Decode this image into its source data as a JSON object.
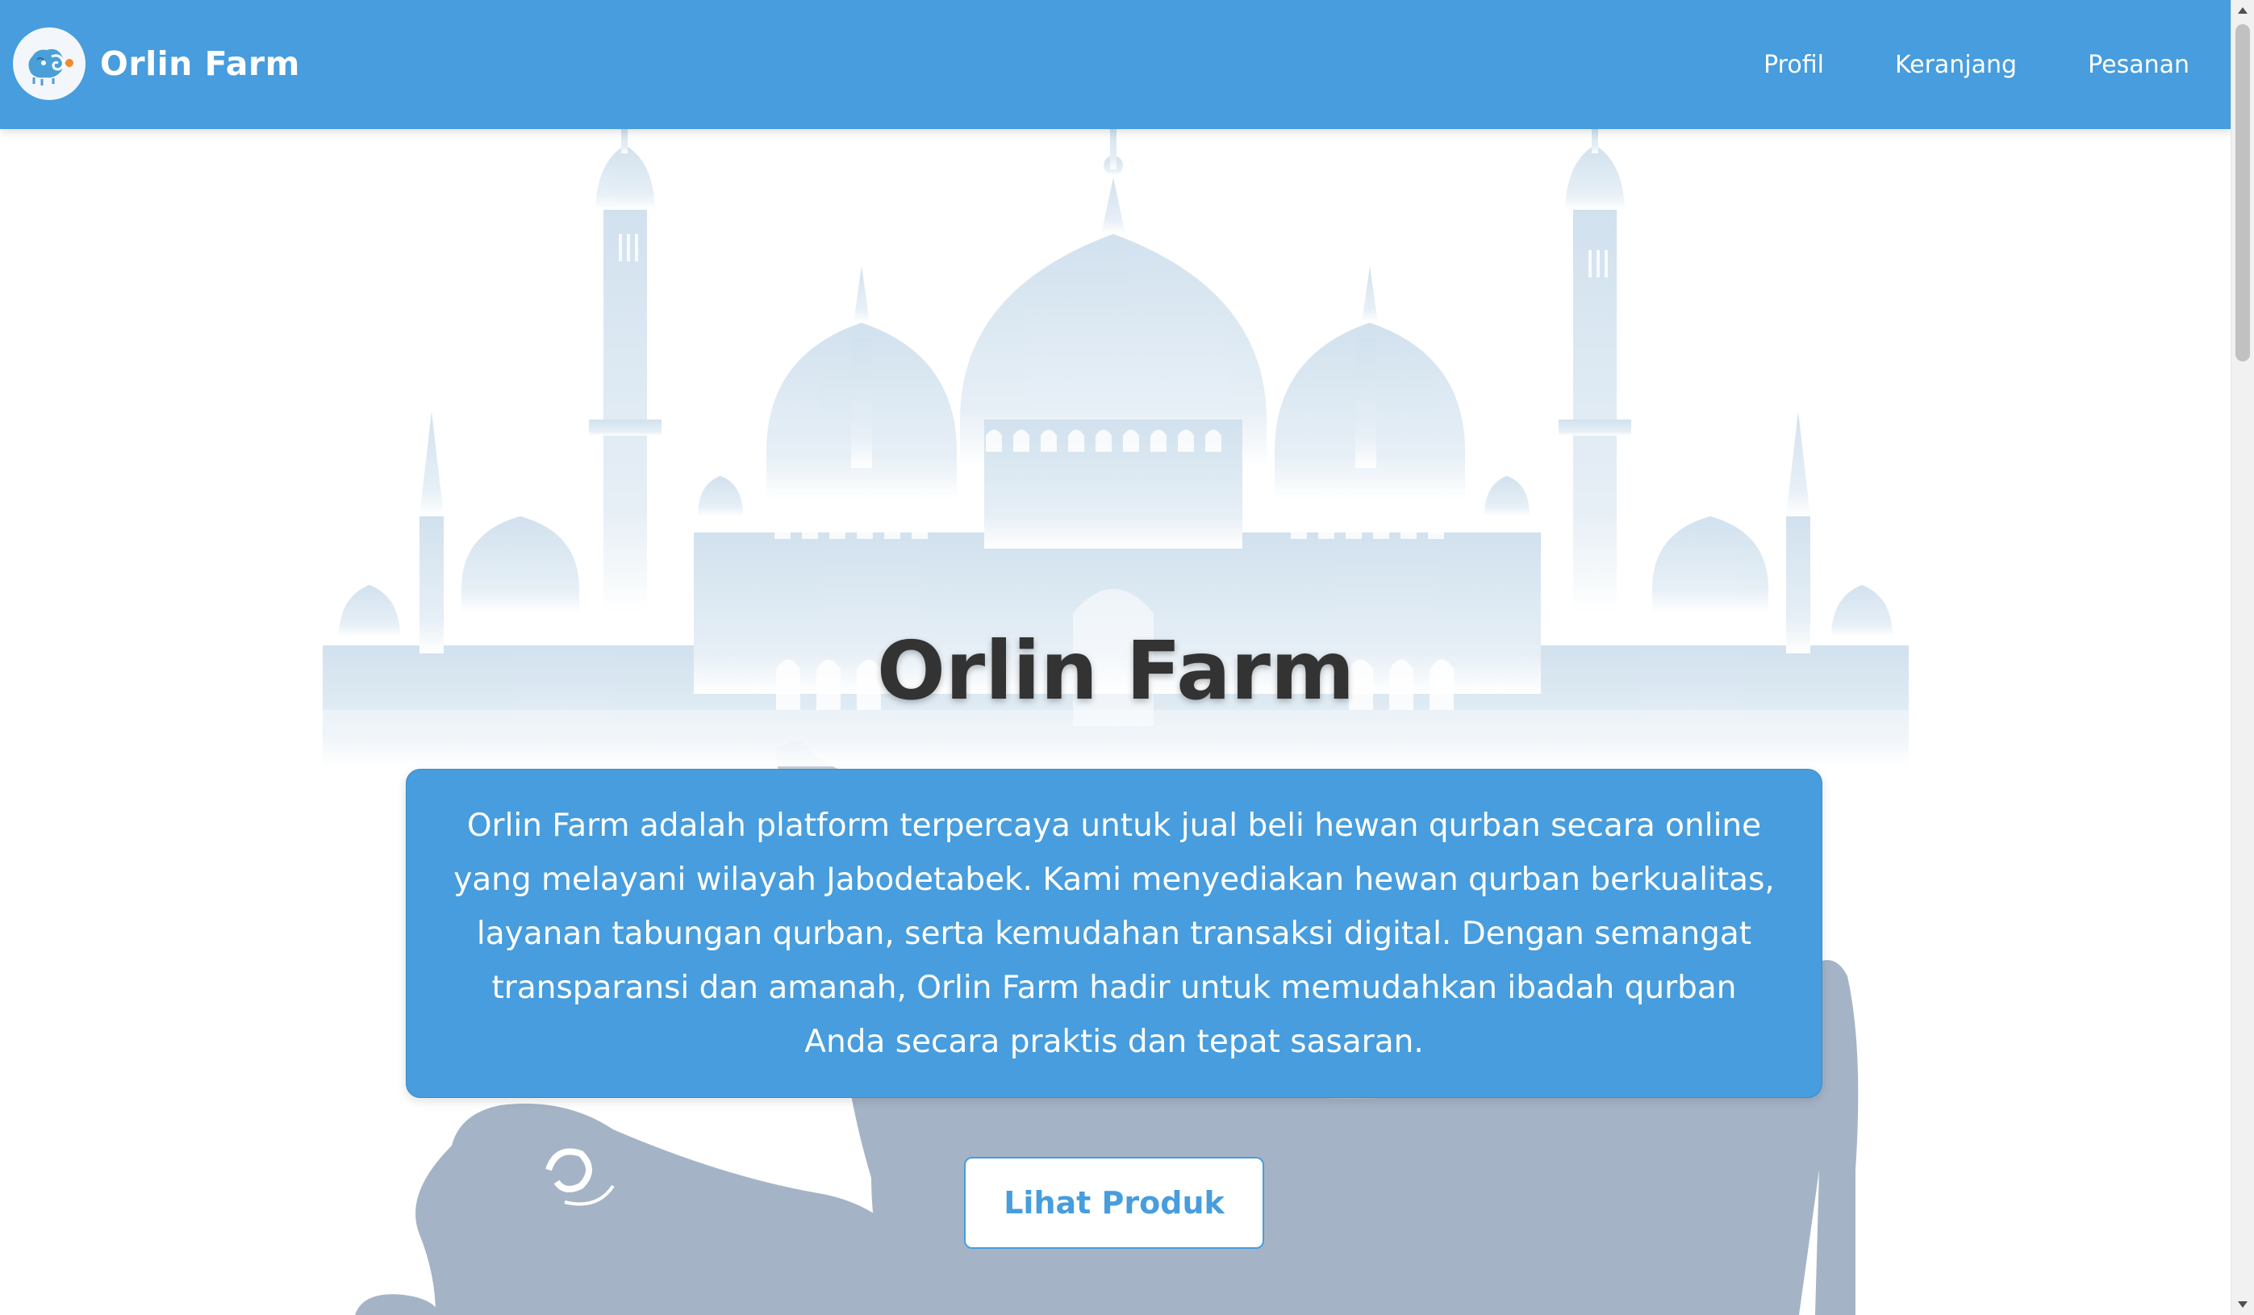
{
  "navbar": {
    "brand": "Orlin Farm",
    "links": [
      "Profil",
      "Keranjang",
      "Pesanan"
    ],
    "background_color": "#479ddd",
    "logo_icon": "sheep-logo-icon"
  },
  "hero": {
    "title": "Orlin Farm",
    "description": "Orlin Farm adalah platform terpercaya untuk jual beli hewan qurban secara online yang melayani wilayah Jabodetabek. Kami menyediakan hewan qurban berkualitas, layanan tabungan qurban, serta kemudahan transaksi digital. Dengan semangat transparansi dan amanah, Orlin Farm hadir untuk memudahkan ibadah qurban Anda secara praktis dan tepat sasaran.",
    "cta_label": "Lihat Produk",
    "background_illustrations": [
      "mosque-silhouette",
      "cow-silhouette",
      "ram-silhouette",
      "sheep-silhouette"
    ]
  },
  "colors": {
    "primary": "#479ddd",
    "title_text": "#333333",
    "mosque_tint": "#d0e2ef",
    "animal_tint": "#a4b4c6"
  }
}
